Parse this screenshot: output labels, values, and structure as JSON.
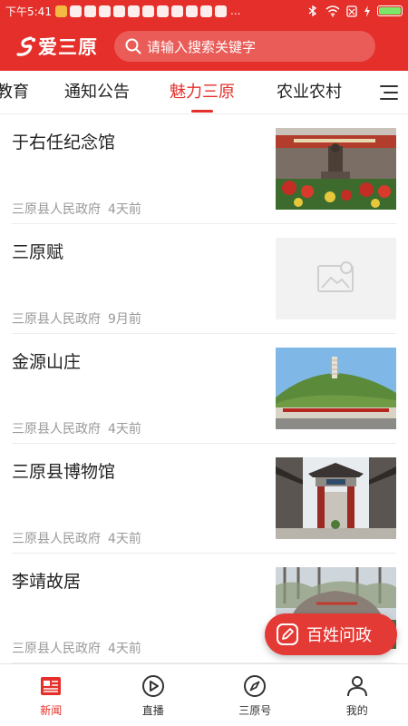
{
  "status_bar": {
    "time": "下午5:41",
    "signal": "...",
    "notification_icons": [
      "app-icon",
      "app-icon",
      "app-icon",
      "app-icon",
      "app-icon",
      "app-icon",
      "app-icon",
      "app-icon",
      "app-icon",
      "app-icon",
      "app-icon",
      "app-icon"
    ],
    "battery_color": "#7be66a"
  },
  "header": {
    "logo_text": "爱三原",
    "search_placeholder": "请输入搜索关键字",
    "brand_color": "#e42f2a"
  },
  "tabs": [
    {
      "label": "教育",
      "active": false
    },
    {
      "label": "通知公告",
      "active": false
    },
    {
      "label": "魅力三原",
      "active": true
    },
    {
      "label": "农业农村",
      "active": false
    }
  ],
  "news": [
    {
      "title": "于右任纪念馆",
      "source": "三原县人民政府",
      "time": "4天前",
      "thumb": "memorial-hall-photo"
    },
    {
      "title": "三原赋",
      "source": "三原县人民政府",
      "time": "9月前",
      "thumb": "placeholder-image-icon"
    },
    {
      "title": "金源山庄",
      "source": "三原县人民政府",
      "time": "4天前",
      "thumb": "hill-pagoda-photo"
    },
    {
      "title": "三原县博物馆",
      "source": "三原县人民政府",
      "time": "4天前",
      "thumb": "museum-gate-photo"
    },
    {
      "title": "李靖故居",
      "source": "三原县人民政府",
      "time": "4天前",
      "thumb": "stone-garden-photo"
    }
  ],
  "fab": {
    "label": "百姓问政"
  },
  "bottom_nav": [
    {
      "label": "新闻",
      "icon": "news-icon",
      "active": true
    },
    {
      "label": "直播",
      "icon": "play-icon",
      "active": false
    },
    {
      "label": "三原号",
      "icon": "compass-icon",
      "active": false
    },
    {
      "label": "我的",
      "icon": "user-icon",
      "active": false
    }
  ]
}
